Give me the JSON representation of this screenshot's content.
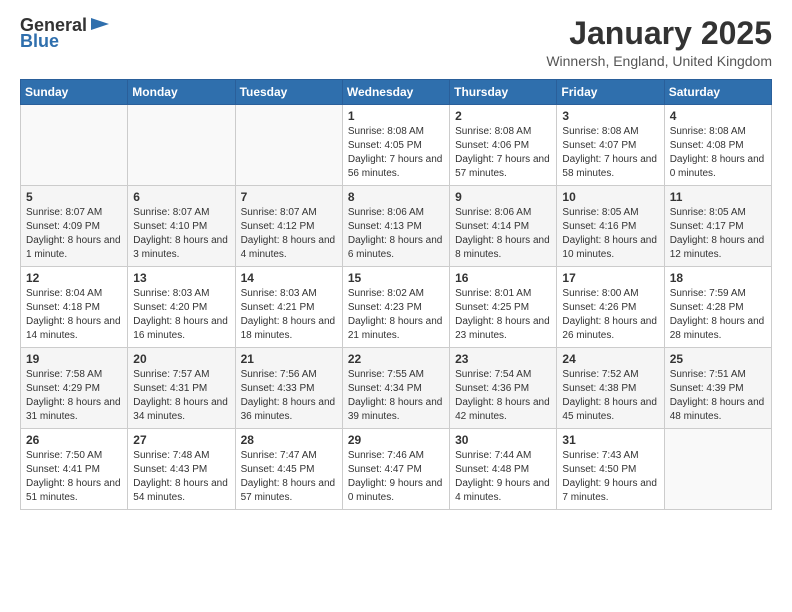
{
  "header": {
    "logo_general": "General",
    "logo_blue": "Blue",
    "month_title": "January 2025",
    "location": "Winnersh, England, United Kingdom"
  },
  "weekdays": [
    "Sunday",
    "Monday",
    "Tuesday",
    "Wednesday",
    "Thursday",
    "Friday",
    "Saturday"
  ],
  "weeks": [
    [
      {
        "num": "",
        "info": ""
      },
      {
        "num": "",
        "info": ""
      },
      {
        "num": "",
        "info": ""
      },
      {
        "num": "1",
        "info": "Sunrise: 8:08 AM\nSunset: 4:05 PM\nDaylight: 7 hours and 56 minutes."
      },
      {
        "num": "2",
        "info": "Sunrise: 8:08 AM\nSunset: 4:06 PM\nDaylight: 7 hours and 57 minutes."
      },
      {
        "num": "3",
        "info": "Sunrise: 8:08 AM\nSunset: 4:07 PM\nDaylight: 7 hours and 58 minutes."
      },
      {
        "num": "4",
        "info": "Sunrise: 8:08 AM\nSunset: 4:08 PM\nDaylight: 8 hours and 0 minutes."
      }
    ],
    [
      {
        "num": "5",
        "info": "Sunrise: 8:07 AM\nSunset: 4:09 PM\nDaylight: 8 hours and 1 minute."
      },
      {
        "num": "6",
        "info": "Sunrise: 8:07 AM\nSunset: 4:10 PM\nDaylight: 8 hours and 3 minutes."
      },
      {
        "num": "7",
        "info": "Sunrise: 8:07 AM\nSunset: 4:12 PM\nDaylight: 8 hours and 4 minutes."
      },
      {
        "num": "8",
        "info": "Sunrise: 8:06 AM\nSunset: 4:13 PM\nDaylight: 8 hours and 6 minutes."
      },
      {
        "num": "9",
        "info": "Sunrise: 8:06 AM\nSunset: 4:14 PM\nDaylight: 8 hours and 8 minutes."
      },
      {
        "num": "10",
        "info": "Sunrise: 8:05 AM\nSunset: 4:16 PM\nDaylight: 8 hours and 10 minutes."
      },
      {
        "num": "11",
        "info": "Sunrise: 8:05 AM\nSunset: 4:17 PM\nDaylight: 8 hours and 12 minutes."
      }
    ],
    [
      {
        "num": "12",
        "info": "Sunrise: 8:04 AM\nSunset: 4:18 PM\nDaylight: 8 hours and 14 minutes."
      },
      {
        "num": "13",
        "info": "Sunrise: 8:03 AM\nSunset: 4:20 PM\nDaylight: 8 hours and 16 minutes."
      },
      {
        "num": "14",
        "info": "Sunrise: 8:03 AM\nSunset: 4:21 PM\nDaylight: 8 hours and 18 minutes."
      },
      {
        "num": "15",
        "info": "Sunrise: 8:02 AM\nSunset: 4:23 PM\nDaylight: 8 hours and 21 minutes."
      },
      {
        "num": "16",
        "info": "Sunrise: 8:01 AM\nSunset: 4:25 PM\nDaylight: 8 hours and 23 minutes."
      },
      {
        "num": "17",
        "info": "Sunrise: 8:00 AM\nSunset: 4:26 PM\nDaylight: 8 hours and 26 minutes."
      },
      {
        "num": "18",
        "info": "Sunrise: 7:59 AM\nSunset: 4:28 PM\nDaylight: 8 hours and 28 minutes."
      }
    ],
    [
      {
        "num": "19",
        "info": "Sunrise: 7:58 AM\nSunset: 4:29 PM\nDaylight: 8 hours and 31 minutes."
      },
      {
        "num": "20",
        "info": "Sunrise: 7:57 AM\nSunset: 4:31 PM\nDaylight: 8 hours and 34 minutes."
      },
      {
        "num": "21",
        "info": "Sunrise: 7:56 AM\nSunset: 4:33 PM\nDaylight: 8 hours and 36 minutes."
      },
      {
        "num": "22",
        "info": "Sunrise: 7:55 AM\nSunset: 4:34 PM\nDaylight: 8 hours and 39 minutes."
      },
      {
        "num": "23",
        "info": "Sunrise: 7:54 AM\nSunset: 4:36 PM\nDaylight: 8 hours and 42 minutes."
      },
      {
        "num": "24",
        "info": "Sunrise: 7:52 AM\nSunset: 4:38 PM\nDaylight: 8 hours and 45 minutes."
      },
      {
        "num": "25",
        "info": "Sunrise: 7:51 AM\nSunset: 4:39 PM\nDaylight: 8 hours and 48 minutes."
      }
    ],
    [
      {
        "num": "26",
        "info": "Sunrise: 7:50 AM\nSunset: 4:41 PM\nDaylight: 8 hours and 51 minutes."
      },
      {
        "num": "27",
        "info": "Sunrise: 7:48 AM\nSunset: 4:43 PM\nDaylight: 8 hours and 54 minutes."
      },
      {
        "num": "28",
        "info": "Sunrise: 7:47 AM\nSunset: 4:45 PM\nDaylight: 8 hours and 57 minutes."
      },
      {
        "num": "29",
        "info": "Sunrise: 7:46 AM\nSunset: 4:47 PM\nDaylight: 9 hours and 0 minutes."
      },
      {
        "num": "30",
        "info": "Sunrise: 7:44 AM\nSunset: 4:48 PM\nDaylight: 9 hours and 4 minutes."
      },
      {
        "num": "31",
        "info": "Sunrise: 7:43 AM\nSunset: 4:50 PM\nDaylight: 9 hours and 7 minutes."
      },
      {
        "num": "",
        "info": ""
      }
    ]
  ]
}
